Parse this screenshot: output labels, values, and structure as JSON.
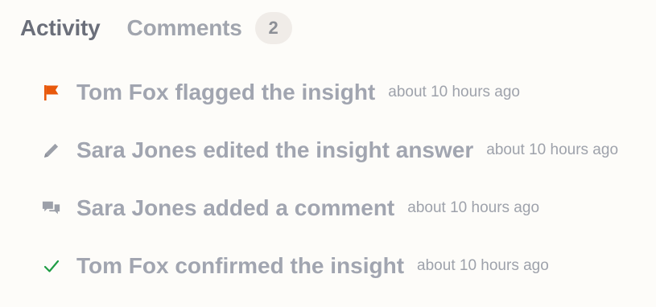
{
  "tabs": [
    {
      "label": "Activity",
      "active": true
    },
    {
      "label": "Comments",
      "active": false,
      "count": "2"
    }
  ],
  "activity": [
    {
      "icon": "flag-icon",
      "icon_color": "#e8590c",
      "message": "Tom Fox flagged the insight",
      "time": "about 10 hours ago"
    },
    {
      "icon": "pencil-icon",
      "icon_color": "#9ca0a9",
      "message": "Sara Jones edited the insight answer",
      "time": "about 10 hours ago"
    },
    {
      "icon": "comments-icon",
      "icon_color": "#9ca0a9",
      "message": "Sara Jones added a comment",
      "time": "about 10 hours ago"
    },
    {
      "icon": "check-icon",
      "icon_color": "#1f9d45",
      "message": "Tom Fox confirmed the insight",
      "time": "about 10 hours ago"
    }
  ]
}
